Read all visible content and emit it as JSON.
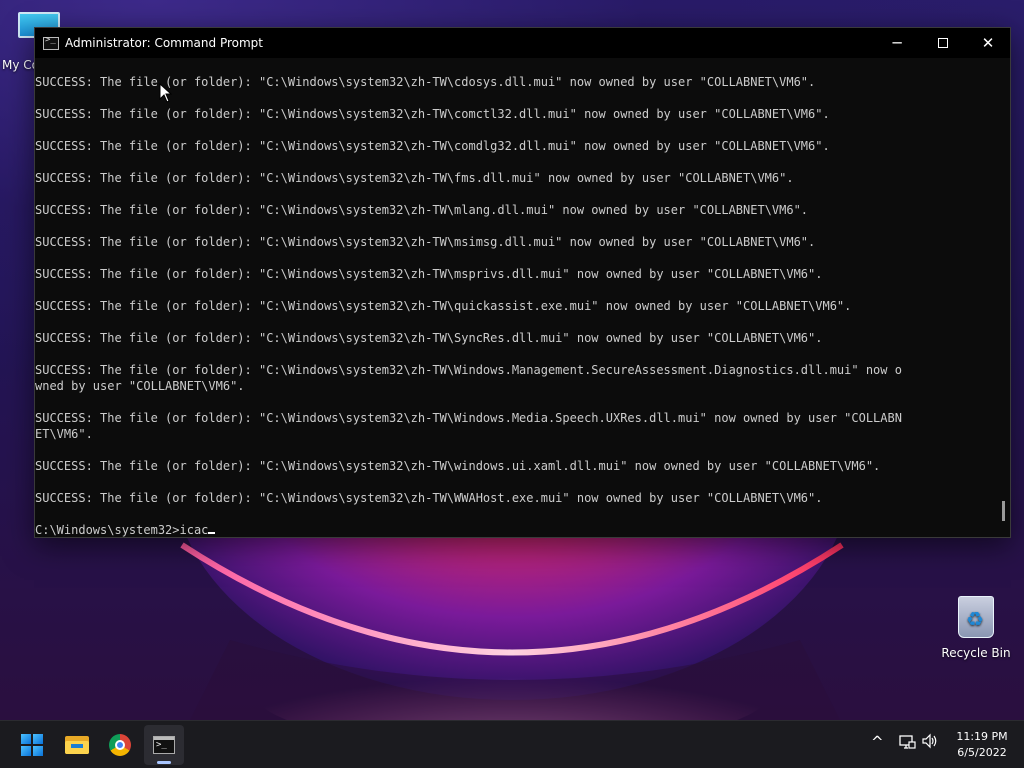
{
  "desktop": {
    "icons": [
      {
        "label": "My Co",
        "icon": "computer-icon"
      },
      {
        "label": "Recycle Bin",
        "icon": "recycle-bin-icon"
      }
    ]
  },
  "window": {
    "title": "Administrator: Command Prompt",
    "controls": {
      "minimize": "─",
      "maximize": "maximize-icon",
      "close": "✕"
    }
  },
  "console": {
    "lines": [
      "SUCCESS: The file (or folder): \"C:\\Windows\\system32\\zh-TW\\cdosys.dll.mui\" now owned by user \"COLLABNET\\VM6\".",
      "",
      "SUCCESS: The file (or folder): \"C:\\Windows\\system32\\zh-TW\\comctl32.dll.mui\" now owned by user \"COLLABNET\\VM6\".",
      "",
      "SUCCESS: The file (or folder): \"C:\\Windows\\system32\\zh-TW\\comdlg32.dll.mui\" now owned by user \"COLLABNET\\VM6\".",
      "",
      "SUCCESS: The file (or folder): \"C:\\Windows\\system32\\zh-TW\\fms.dll.mui\" now owned by user \"COLLABNET\\VM6\".",
      "",
      "SUCCESS: The file (or folder): \"C:\\Windows\\system32\\zh-TW\\mlang.dll.mui\" now owned by user \"COLLABNET\\VM6\".",
      "",
      "SUCCESS: The file (or folder): \"C:\\Windows\\system32\\zh-TW\\msimsg.dll.mui\" now owned by user \"COLLABNET\\VM6\".",
      "",
      "SUCCESS: The file (or folder): \"C:\\Windows\\system32\\zh-TW\\msprivs.dll.mui\" now owned by user \"COLLABNET\\VM6\".",
      "",
      "SUCCESS: The file (or folder): \"C:\\Windows\\system32\\zh-TW\\quickassist.exe.mui\" now owned by user \"COLLABNET\\VM6\".",
      "",
      "SUCCESS: The file (or folder): \"C:\\Windows\\system32\\zh-TW\\SyncRes.dll.mui\" now owned by user \"COLLABNET\\VM6\".",
      "",
      "SUCCESS: The file (or folder): \"C:\\Windows\\system32\\zh-TW\\Windows.Management.SecureAssessment.Diagnostics.dll.mui\" now o",
      "wned by user \"COLLABNET\\VM6\".",
      "",
      "SUCCESS: The file (or folder): \"C:\\Windows\\system32\\zh-TW\\Windows.Media.Speech.UXRes.dll.mui\" now owned by user \"COLLABN",
      "ET\\VM6\".",
      "",
      "SUCCESS: The file (or folder): \"C:\\Windows\\system32\\zh-TW\\windows.ui.xaml.dll.mui\" now owned by user \"COLLABNET\\VM6\".",
      "",
      "SUCCESS: The file (or folder): \"C:\\Windows\\system32\\zh-TW\\WWAHost.exe.mui\" now owned by user \"COLLABNET\\VM6\".",
      ""
    ],
    "prompt": "C:\\Windows\\system32>",
    "input_value": "icac"
  },
  "taskbar": {
    "apps": [
      {
        "name": "start",
        "icon": "windows-logo-icon"
      },
      {
        "name": "file-explorer",
        "icon": "folder-icon"
      },
      {
        "name": "chrome",
        "icon": "chrome-icon"
      },
      {
        "name": "command-prompt",
        "icon": "terminal-icon",
        "active": true
      }
    ],
    "tray": {
      "chevron": "^",
      "clock_time": "11:19 PM",
      "clock_date": "6/5/2022"
    }
  }
}
